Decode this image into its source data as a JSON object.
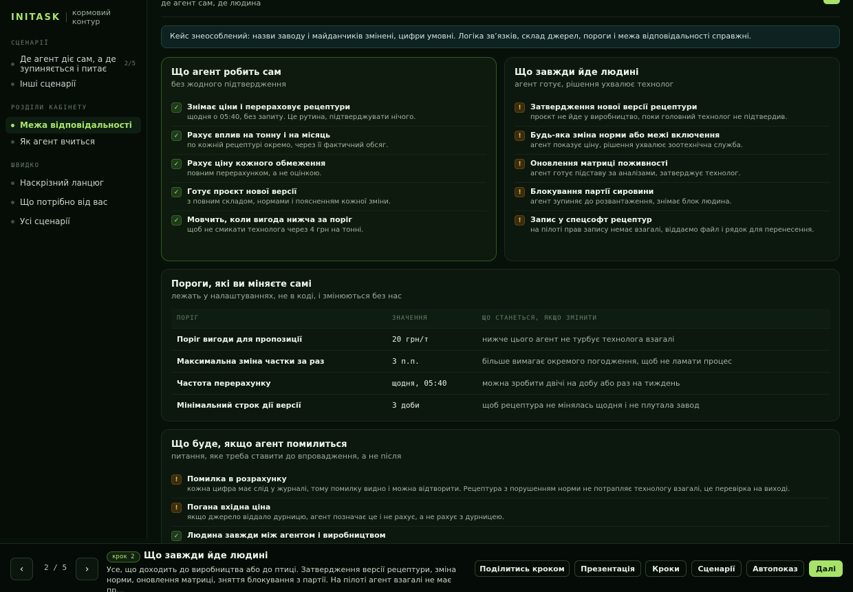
{
  "brand": {
    "logo": "INITASK",
    "subtitle": "кормовий контур"
  },
  "sidebar": {
    "section1": "СЦЕНАРІЇ",
    "scenarios": [
      {
        "label": "Де агент діє сам, а де зупиняється і питає",
        "count": "2/5"
      },
      {
        "label": "Інші сценарії"
      }
    ],
    "section2": "РОЗДІЛИ КАБІНЕТУ",
    "cabinet": [
      {
        "label": "Межа відповідальності"
      },
      {
        "label": "Як агент вчиться"
      }
    ],
    "section3": "ШВИДКО",
    "quick": [
      {
        "label": "Наскрізний ланцюг"
      },
      {
        "label": "Що потрібно від вас"
      },
      {
        "label": "Усі сценарії"
      }
    ]
  },
  "main": {
    "top_text": "де агент сам, де людина",
    "notice": "Кейс знеособлений: назви заводу і майданчиків змінені, цифри умовні. Логіка зв’язків, склад джерел, пороги і межа відповідальності справжні.",
    "agent_card": {
      "title": "Що агент робить сам",
      "subtitle": "без жодного підтвердження",
      "items": [
        {
          "title": "Знімає ціни і перераховує рецептури",
          "desc": "щодня о 05:40, без запиту. Це рутина, підтверджувати нічого."
        },
        {
          "title": "Рахує вплив на тонну і на місяць",
          "desc": "по кожній рецептурі окремо, через її фактичний обсяг."
        },
        {
          "title": "Рахує ціну кожного обмеження",
          "desc": "повним перерахунком, а не оцінкою."
        },
        {
          "title": "Готує проєкт нової версії",
          "desc": "з повним складом, нормами і поясненням кожної зміни."
        },
        {
          "title": "Мовчить, коли вигода нижча за поріг",
          "desc": "щоб не смикати технолога через 4 грн на тонні."
        }
      ]
    },
    "human_card": {
      "title": "Що завжди йде людині",
      "subtitle": "агент готує, рішення ухвалює технолог",
      "items": [
        {
          "title": "Затвердження нової версії рецептури",
          "desc": "проєкт не йде у виробництво, поки головний технолог не підтвердив."
        },
        {
          "title": "Будь-яка зміна норми або межі включення",
          "desc": "агент показує ціну, рішення ухвалює зоотехнічна служба."
        },
        {
          "title": "Оновлення матриці поживності",
          "desc": "агент готує підставу за аналізами, затверджує технолог."
        },
        {
          "title": "Блокування партії сировини",
          "desc": "агент зупиняє до розвантаження, знімає блок людина."
        },
        {
          "title": "Запис у спецсофт рецептур",
          "desc": "на пілоті прав запису немає взагалі, віддаємо файл і рядок для перенесення."
        }
      ]
    },
    "thresholds": {
      "title": "Пороги, які ви міняєте самі",
      "subtitle": "лежать у налаштуваннях, не в коді, і змінюються без нас",
      "headers": [
        "ПОРІГ",
        "ЗНАЧЕННЯ",
        "ЩО СТАНЕТЬСЯ, ЯКЩО ЗМІНИТИ"
      ],
      "rows": [
        {
          "name": "Поріг вигоди для пропозиції",
          "value": "20 грн/т",
          "effect": "нижче цього агент не турбує технолога взагалі"
        },
        {
          "name": "Максимальна зміна частки за раз",
          "value": "3 п.п.",
          "effect": "більше вимагає окремого погодження, щоб не ламати процес"
        },
        {
          "name": "Частота перерахунку",
          "value": "щодня, 05:40",
          "effect": "можна зробити двічі на добу або раз на тиждень"
        },
        {
          "name": "Мінімальний строк дії версії",
          "value": "3 доби",
          "effect": "щоб рецептура не мінялась щодня і не плутала завод"
        }
      ]
    },
    "errors": {
      "title": "Що буде, якщо агент помилиться",
      "subtitle": "питання, яке треба ставити до впровадження, а не після",
      "items": [
        {
          "kind": "warn",
          "title": "Помилка в розрахунку",
          "desc": "кожна цифра має слід у журналі, тому помилку видно і можна відтворити. Рецептура з порушенням норми не потрапляє технологу взагалі, це перевірка на виході."
        },
        {
          "kind": "warn",
          "title": "Погана вхідна ціна",
          "desc": "якщо джерело віддало дурницю, агент позначає це і не рахує, а не рахує з дурницею."
        },
        {
          "kind": "ok",
          "title": "Людина завжди між агентом і виробництвом",
          "desc": ""
        }
      ]
    }
  },
  "bottom": {
    "prev": "‹",
    "next": "›",
    "pager": "2 / 5",
    "step_badge": "крок 2",
    "step_title": "Що завжди йде людині",
    "step_text": "Усе, що доходить до виробництва або до птиці. Затвердження версії рецептури, зміна норми, оновлення матриці, зняття блокування з партії. На пілоті агент взагалі не має пр...",
    "actions": [
      "Поділитись кроком",
      "Презентація",
      "Кроки",
      "Сценарії",
      "Автопоказ",
      "Далі"
    ]
  }
}
